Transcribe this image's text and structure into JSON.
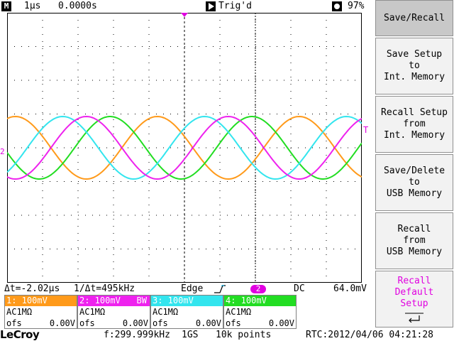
{
  "top_bar": {
    "mark": "M",
    "timebase": "1µs",
    "delay": "0.0000s",
    "trigger_status": "Trig'd",
    "battery": "97%"
  },
  "measurements": {
    "delta_t": "Δt=-2.02µs",
    "inv_delta_t": "1/Δt=495kHz",
    "trigger_type": "Edge",
    "trigger_channel": "2",
    "coupling": "DC",
    "trigger_level": "64.0mV"
  },
  "channels": [
    {
      "header": "1: 100mV",
      "bw": "",
      "coupling": "AC1MΩ",
      "ofs_label": "ofs",
      "ofs_value": "0.00V",
      "color": "#ff9a1a"
    },
    {
      "header": "2: 100mV",
      "bw": "BW",
      "coupling": "AC1MΩ",
      "ofs_label": "ofs",
      "ofs_value": "0.00V",
      "color": "#ee22ee"
    },
    {
      "header": "3: 100mV",
      "bw": "",
      "coupling": "AC1MΩ",
      "ofs_label": "ofs",
      "ofs_value": "0.00V",
      "color": "#33e5ee"
    },
    {
      "header": "4: 100mV",
      "bw": "",
      "coupling": "AC1MΩ",
      "ofs_label": "ofs",
      "ofs_value": "0.00V",
      "color": "#22dd22"
    }
  ],
  "bottom_bar": {
    "logo": "LeCroy",
    "frequency": "f:299.999kHz",
    "sample_rate": "1GS",
    "points": "10k points",
    "rtc": "RTC:2012/04/06 04:21:28"
  },
  "menu": {
    "title": "Save/Recall",
    "items": [
      {
        "lines": [
          "Save Setup",
          "to",
          "Int. Memory"
        ]
      },
      {
        "lines": [
          "Recall Setup",
          "from",
          "Int. Memory"
        ]
      },
      {
        "lines": [
          "Save/Delete",
          "to",
          "USB Memory"
        ]
      },
      {
        "lines": [
          "Recall",
          "from",
          "USB Memory"
        ]
      },
      {
        "lines": [
          "Recall",
          "Default",
          "Setup"
        ]
      }
    ]
  },
  "markers": {
    "trigger_level_marker": "T",
    "channel_ground_marker": "2"
  },
  "colors": {
    "ch1": "#ff9a1a",
    "ch2": "#ee22ee",
    "ch3": "#33e5ee",
    "ch4": "#22dd22",
    "grid": "#000000",
    "trigger": "#e000e0"
  }
}
